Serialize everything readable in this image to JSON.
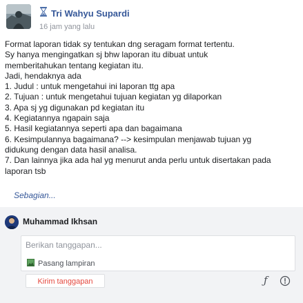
{
  "post": {
    "author": "Tri Wahyu Supardi",
    "timestamp": "16 jam yang lalu",
    "lines": [
      "Format laporan tidak sy tentukan dng seragam format tertentu.",
      "Sy hanya mengingatkan sj bhw laporan itu dibuat untuk",
      "memberitahukan tentang kegiatan itu.",
      "Jadi, hendaknya ada",
      "1. Judul : untuk mengetahui ini laporan ttg apa",
      "2. Tujuan : untuk mengetahui tujuan kegiatan yg dilaporkan",
      "3. Apa sj yg digunakan pd kegiatan itu",
      "4. Kegiatannya ngapain saja",
      "5. Hasil kegiatannya seperti apa dan bagaimana",
      "6. Kesimpulannya bagaimana? --> kesimpulan menjawab tujuan yg",
      "didukung dengan data hasil analisa.",
      "7. Dan lainnya jika ada hal yg menurut anda perlu untuk disertakan pada",
      "laporan tsb"
    ],
    "see_more": "Sebagian..."
  },
  "comment": {
    "user_name": "Muhammad Ikhsan",
    "placeholder": "Berikan tanggapan...",
    "attach_label": "Pasang lampiran",
    "submit_label": "Kirim tanggapan"
  },
  "icons": {
    "hourglass": "hourglass-icon",
    "attachment": "image-attachment-icon",
    "format": "formula-icon",
    "more": "more-options-icon"
  },
  "colors": {
    "link": "#365899",
    "submit_text": "#e4473e",
    "comment_bg": "#f2f3f5"
  }
}
